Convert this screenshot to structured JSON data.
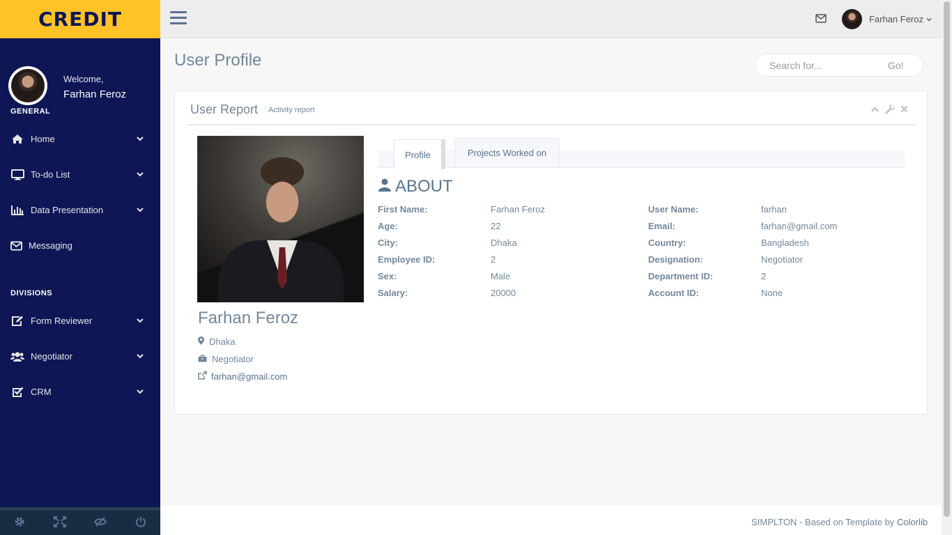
{
  "brand": {
    "name": "CREDIT",
    "accent": "#ffc328",
    "sidebar_bg": "#0e1655"
  },
  "sidebar": {
    "welcome": "Welcome,",
    "user": "Farhan Feroz",
    "general_title": "GENERAL",
    "general_items": [
      {
        "label": "Home",
        "icon": "home-icon",
        "has_chevron": true
      },
      {
        "label": "To-do List",
        "icon": "desktop-icon",
        "has_chevron": true
      },
      {
        "label": "Data Presentation",
        "icon": "bar-chart-icon",
        "has_chevron": true
      },
      {
        "label": "Messaging",
        "icon": "envelope-icon",
        "has_chevron": false
      }
    ],
    "divisions_title": "DIVISIONS",
    "division_items": [
      {
        "label": "Form Reviewer",
        "icon": "edit-icon",
        "has_chevron": true
      },
      {
        "label": "Negotiator",
        "icon": "users-icon",
        "has_chevron": true
      },
      {
        "label": "CRM",
        "icon": "check-square-icon",
        "has_chevron": true
      }
    ],
    "footer_icons": [
      "settings-icon",
      "fullscreen-icon",
      "lock-icon",
      "power-icon"
    ]
  },
  "topnav": {
    "user_name": "Farhan Feroz"
  },
  "page": {
    "title": "User Profile",
    "search_placeholder": "Search for...",
    "search_button": "Go!"
  },
  "panel": {
    "title": "User Report",
    "subtitle": "Activity report"
  },
  "profile": {
    "name": "Farhan Feroz",
    "city": "Dhaka",
    "role": "Negotiator",
    "email": "farhan@gmail.com"
  },
  "tabs": [
    {
      "label": "Profile",
      "active": true
    },
    {
      "label": "Projects Worked on",
      "active": false
    }
  ],
  "about": {
    "heading": "ABOUT",
    "left": [
      {
        "label": "First Name:",
        "value": "Farhan Feroz"
      },
      {
        "label": "Age:",
        "value": "22"
      },
      {
        "label": "City:",
        "value": "Dhaka"
      },
      {
        "label": "Employee ID:",
        "value": "2"
      },
      {
        "label": "Sex:",
        "value": "Male"
      },
      {
        "label": "Salary:",
        "value": "20000"
      }
    ],
    "right": [
      {
        "label": "User Name:",
        "value": "farhan"
      },
      {
        "label": "Email:",
        "value": "farhan@gmail.com"
      },
      {
        "label": "Country:",
        "value": "Bangladesh"
      },
      {
        "label": "Designation:",
        "value": "Negotiator"
      },
      {
        "label": "Department ID:",
        "value": "2"
      },
      {
        "label": "Account ID:",
        "value": "None"
      }
    ]
  },
  "footer": {
    "text": "SIMPLTON - Based on Template by ",
    "link": "Colorlib"
  }
}
